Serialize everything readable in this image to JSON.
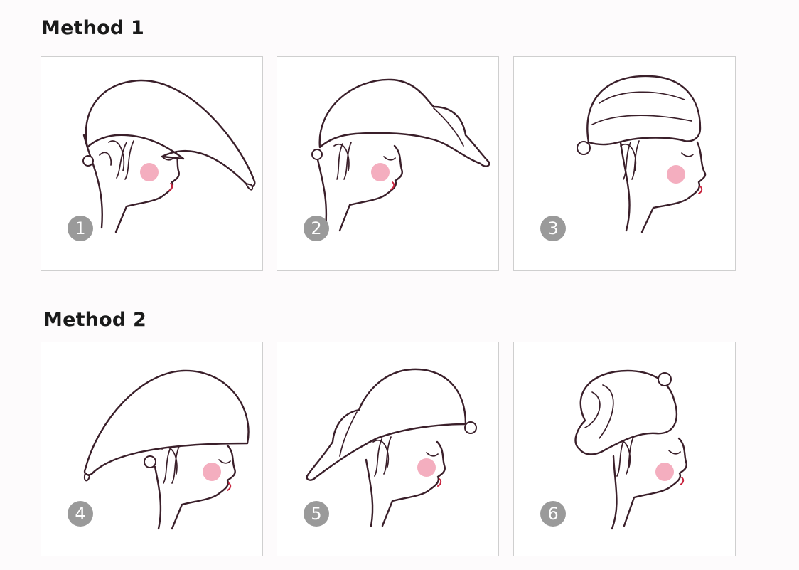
{
  "sections": [
    {
      "title": "Method 1",
      "steps": [
        {
          "label": "1"
        },
        {
          "label": "2"
        },
        {
          "label": "3"
        }
      ]
    },
    {
      "title": "Method 2",
      "steps": [
        {
          "label": "4"
        },
        {
          "label": "5"
        },
        {
          "label": "6"
        }
      ]
    }
  ],
  "colors": {
    "ink": "#3a1f2a",
    "blush": "#f2a0b4",
    "lip": "#c8243e",
    "badge": "#9a9a9a"
  },
  "icons": [
    "towel-wrap-step-illustration"
  ]
}
